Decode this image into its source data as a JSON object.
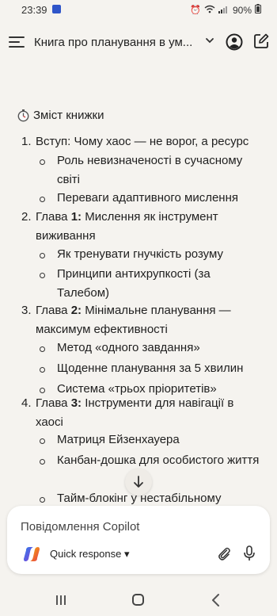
{
  "status_bar": {
    "time": "23:39",
    "battery": "90%",
    "icons": [
      "alarm-icon",
      "wifi-icon",
      "signal-icon",
      "battery-icon"
    ]
  },
  "header": {
    "title": "Книга про планування в ум...",
    "icons": [
      "menu-icon",
      "chevron-down-icon",
      "profile-icon",
      "new-chat-icon"
    ]
  },
  "content": {
    "section_title": "Зміст книжки",
    "chapters": [
      {
        "number": "1.",
        "prefix": "",
        "text": "Вступ: Чому хаос — не ворог, а ресурс",
        "items": [
          "Роль невизначеності в сучасному світі",
          "Переваги адаптивного мислення"
        ]
      },
      {
        "number": "2.",
        "prefix": "Глава ",
        "bold": "1:",
        "text": " Мислення як інструмент виживання",
        "items": [
          "Як тренувати гнучкість розуму",
          "Принципи антихрупкості (за Талебом)"
        ]
      },
      {
        "number": "3.",
        "prefix": "Глава ",
        "bold": "2:",
        "text": " Мінімальне планування — максимум ефективності",
        "items": [
          "Метод «одного завдання»",
          "Щоденне планування за 5 хвилин",
          "Система «трьох пріоритетів»"
        ]
      },
      {
        "number": "4.",
        "prefix": "Глава ",
        "bold": "3:",
        "text": " Інструменти для навігації в хаосі",
        "items": [
          "Матриця Ейзенхауера",
          "Канбан-дошка для особистого життя",
          "Тайм-блокінг у нестабільному"
        ]
      }
    ]
  },
  "composer": {
    "placeholder": "Повідомлення Copilot",
    "mode_label": "Quick response",
    "icons": [
      "copilot-logo-icon",
      "attach-icon",
      "mic-icon"
    ]
  },
  "colors": {
    "background": "#f5f3ef",
    "composer_bg": "#ffffff",
    "text": "#1f1f1f"
  }
}
